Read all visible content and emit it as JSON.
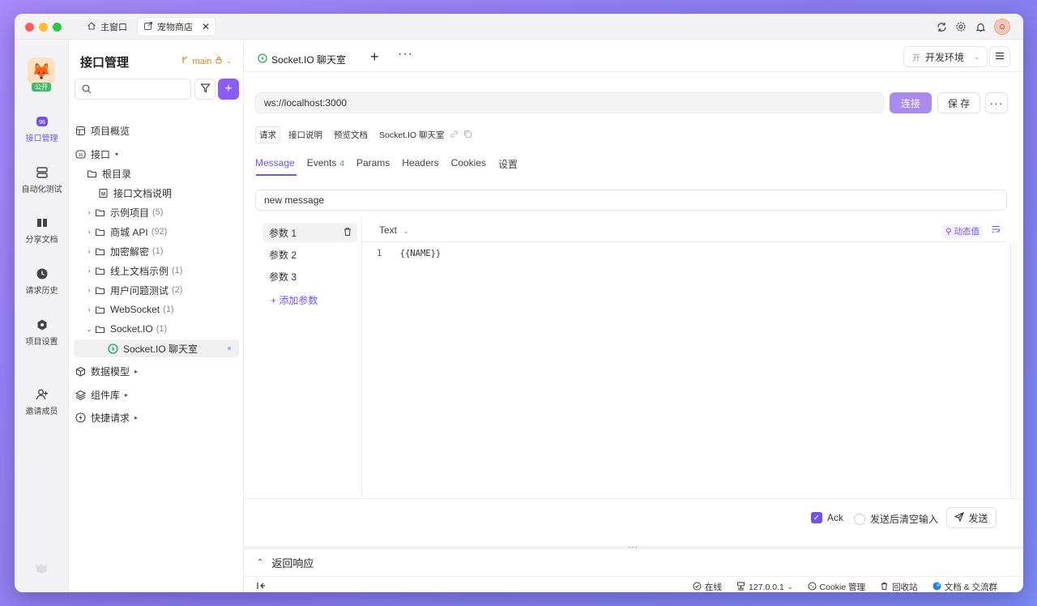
{
  "window_tabs": [
    {
      "label": "主窗口"
    },
    {
      "label": "宠物商店"
    }
  ],
  "rail": {
    "public_badge": "公开",
    "items": [
      {
        "label": "接口管理",
        "icon": "api-icon",
        "active": true
      },
      {
        "label": "自动化测试",
        "icon": "test-icon"
      },
      {
        "label": "分享文档",
        "icon": "book-icon"
      },
      {
        "label": "请求历史",
        "icon": "clock-icon"
      },
      {
        "label": "项目设置",
        "icon": "settings-icon"
      },
      {
        "label": "邀请成员",
        "icon": "add-user-icon"
      }
    ]
  },
  "sidebar": {
    "title": "接口管理",
    "branch": "main",
    "tree": [
      {
        "label": "项目概览",
        "count": ""
      },
      {
        "label": "接口",
        "count": ""
      },
      {
        "label": "根目录",
        "count": ""
      },
      {
        "label": "接口文档说明",
        "count": ""
      },
      {
        "label": "示例项目",
        "count": "(5)"
      },
      {
        "label": "商城 API",
        "count": "(92)"
      },
      {
        "label": "加密解密",
        "count": "(1)"
      },
      {
        "label": "线上文档示例",
        "count": "(1)"
      },
      {
        "label": "用户问题测试",
        "count": "(2)"
      },
      {
        "label": "WebSocket",
        "count": "(1)"
      },
      {
        "label": "Socket.IO",
        "count": "(1)"
      },
      {
        "label": "Socket.IO 聊天室",
        "count": ""
      },
      {
        "label": "数据模型",
        "count": ""
      },
      {
        "label": "组件库",
        "count": ""
      },
      {
        "label": "快捷请求",
        "count": ""
      }
    ]
  },
  "main": {
    "tab_label": "Socket.IO 聊天室",
    "env": {
      "prefix": "开",
      "label": "开发环境"
    },
    "url": "ws://localhost:3000",
    "connect_label": "连接",
    "save_label": "保 存",
    "subtabs": [
      "请求",
      "接口说明",
      "预览文档"
    ],
    "api_name": "Socket.IO 聊天室",
    "req_tabs": [
      {
        "label": "Message",
        "badge": ""
      },
      {
        "label": "Events",
        "badge": "4"
      },
      {
        "label": "Params",
        "badge": ""
      },
      {
        "label": "Headers",
        "badge": ""
      },
      {
        "label": "Cookies",
        "badge": ""
      },
      {
        "label": "设置",
        "badge": ""
      }
    ],
    "event_name": "new message",
    "params": [
      "参数 1",
      "参数 2",
      "参数 3"
    ],
    "add_param": "+ 添加参数",
    "body_type": "Text",
    "dynamic_value": "动态值",
    "code": [
      {
        "line": "1",
        "text": "{{NAME}}"
      }
    ],
    "ack_label": "Ack",
    "ack_checked": true,
    "clear_label": "发送后清空输入",
    "send_label": "发送",
    "response_label": "返回响应"
  },
  "status": {
    "online": "在线",
    "host": "127.0.0.1",
    "cookie": "Cookie 管理",
    "recycle": "回收站",
    "docs": "文档 & 交流群"
  },
  "colors": {
    "accent": "#7352e3",
    "connect_button": "#a98bf0",
    "public_badge": "#43b96b"
  }
}
